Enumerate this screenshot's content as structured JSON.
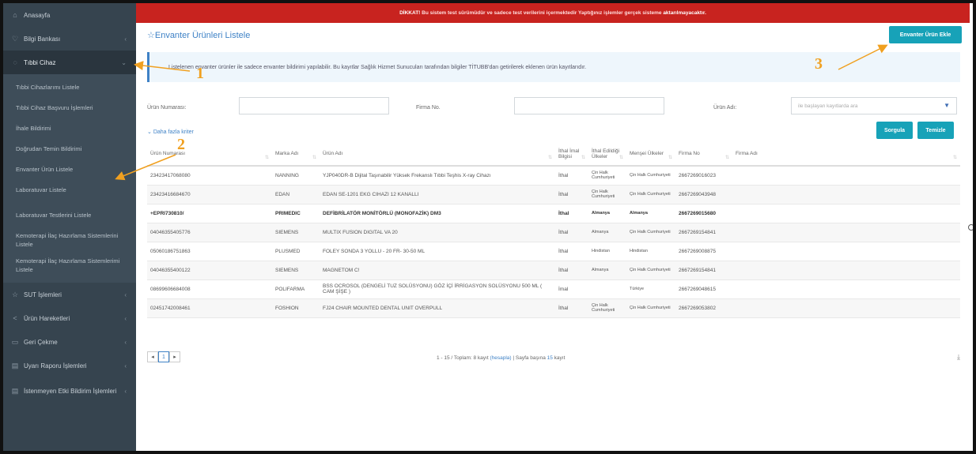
{
  "banner": {
    "prefix": "DİKKAT!",
    "text": " Bu sistem test sürümüdür ve sadece test verilerini içermektedir Yaptığınız işlemler gerçek sisteme ",
    "emph": "aktarılmayacaktır."
  },
  "sidebar": {
    "items": [
      {
        "label": "Anasayfa",
        "icon": "home-icon"
      },
      {
        "label": "Bilgi Bankası",
        "icon": "bulb-icon"
      },
      {
        "label": "Tıbbi Cihaz",
        "icon": "device-icon"
      }
    ],
    "sub_items": [
      "Tıbbi Cihazlarımı Listele",
      "Tıbbi Cihaz Başvuru İşlemleri",
      "İhale Bildirimi",
      "Doğrudan Temin Bildirimi",
      "Envanter Ürün Listele",
      "Laboratuvar Listele",
      "Laboratuvar Testlerini Listele",
      "Kemoterapi İlaç Hazırlama Sistemlerini Listele",
      "Kemoterapi İlaç Hazırlama Sistemlerimi Listele"
    ],
    "bottom_items": [
      {
        "label": "SUT İşlemleri",
        "icon": "star-icon"
      },
      {
        "label": "Ürün Hareketleri",
        "icon": "share-icon"
      },
      {
        "label": "Geri Çekme",
        "icon": "box-icon"
      },
      {
        "label": "Uyarı Raporu İşlemleri",
        "icon": "report-icon"
      },
      {
        "label": "İstenmeyen Etki Bildirim İşlemleri",
        "icon": "report-icon"
      }
    ]
  },
  "page": {
    "title": "☆Envanter Ürünleri Listele",
    "add_button": "Envanter Ürün Ekle",
    "info": "Listelenen envanter ürünler ile sadece envanter bildirimi yapılabilir. Bu kayıtlar Sağlık Hizmet Sunucuları tarafından bilgiler TİTUBB'dan getirilerek eklenen ürün kayıtlarıdır."
  },
  "filters": {
    "urun_no_label": "Ürün Numarası:",
    "firma_no_label": "Firma No.",
    "urun_adi_label": "Ürün Adı:",
    "urun_adi_placeholder": "ile başlayan kayıtlarda ara",
    "more": "Daha fazla kriter",
    "search_button": "Sorgula",
    "clear_button": "Temizle"
  },
  "table": {
    "headers": [
      "Ürün Numarası",
      "Marka Adı",
      "Ürün Adı",
      "İthal İmal Bilgisi",
      "İthal Edildiği Ülkeler",
      "Menşei Ülkeler",
      "Firma No",
      "Firma Adı"
    ],
    "rows": [
      [
        "23423417068080",
        "NANNING",
        "YJP040DR-B Dijital Taşınabilir Yüksek Frekanslı Tıbbi Teşhis X-ray Cihazı",
        "İthal",
        "Çin Halk Cumhuriyeti",
        "Çin Halk Cumhuriyeti",
        "2667269016023",
        ""
      ],
      [
        "23423416684670",
        "EDAN",
        "EDAN SE-1201 EKG CIHAZI 12 KANALLI",
        "İthal",
        "Çin Halk Cumhuriyeti",
        "Çin Halk Cumhuriyeti",
        "2667269043948",
        ""
      ],
      [
        "+EPRI730810/",
        "PRIMEDIC",
        "DEFİBRİLATÖR MONİTÖRLÜ (MONOFAZİK) DM3",
        "İthal",
        "Almanya",
        "Almanya",
        "2667269015680",
        ""
      ],
      [
        "04046355405776",
        "SIEMENS",
        "MULTIX FUSION DIGITAL VA 20",
        "İthal",
        "Almanya",
        "Çin Halk Cumhuriyeti",
        "2667269154841",
        ""
      ],
      [
        "05060186751863",
        "PLUSMED",
        "FOLEY SONDA 3 YOLLU - 20 FR- 30-50 ML",
        "İthal",
        "Hindistan",
        "Hindistan",
        "2667269008875",
        ""
      ],
      [
        "04046355400122",
        "SIEMENS",
        "MAGNETOM C!",
        "İthal",
        "Almanya",
        "Çin Halk Cumhuriyeti",
        "2667269154841",
        ""
      ],
      [
        "08699606684008",
        "POLIFARMA",
        "BSS OCROSOL (DENGELİ TUZ SOLÜSYONU) GÖZ İÇİ İRRİGASYON SOLÜSYONU 500 ML ( CAM ŞİŞE )",
        "İmal",
        "",
        "Türkiye",
        "2667269048615",
        ""
      ],
      [
        "02451742008461",
        "FOSHION",
        "FJ24 CHAIR MOUNTED DENTAL UNIT OVERPULL",
        "İthal",
        "Çin Halk Cumhuriyeti",
        "Çin Halk Cumhuriyeti",
        "2667269053802",
        ""
      ]
    ]
  },
  "pager": {
    "prev": "◂",
    "current": "1",
    "next": "▸",
    "summary": "1 - 15 / Toplam: 8 kayıt ",
    "hesapla": "(hesapla)",
    "per_page": " | Sayfa başına ",
    "per_page_value": "15",
    "suffix": " kayıt"
  },
  "annotations": [
    "1",
    "2",
    "3"
  ],
  "colors": {
    "sidebar": "#36444f",
    "banner": "#c8231f",
    "accent": "#17a2b8",
    "link": "#3f82c6",
    "annotation": "#f0a020"
  }
}
